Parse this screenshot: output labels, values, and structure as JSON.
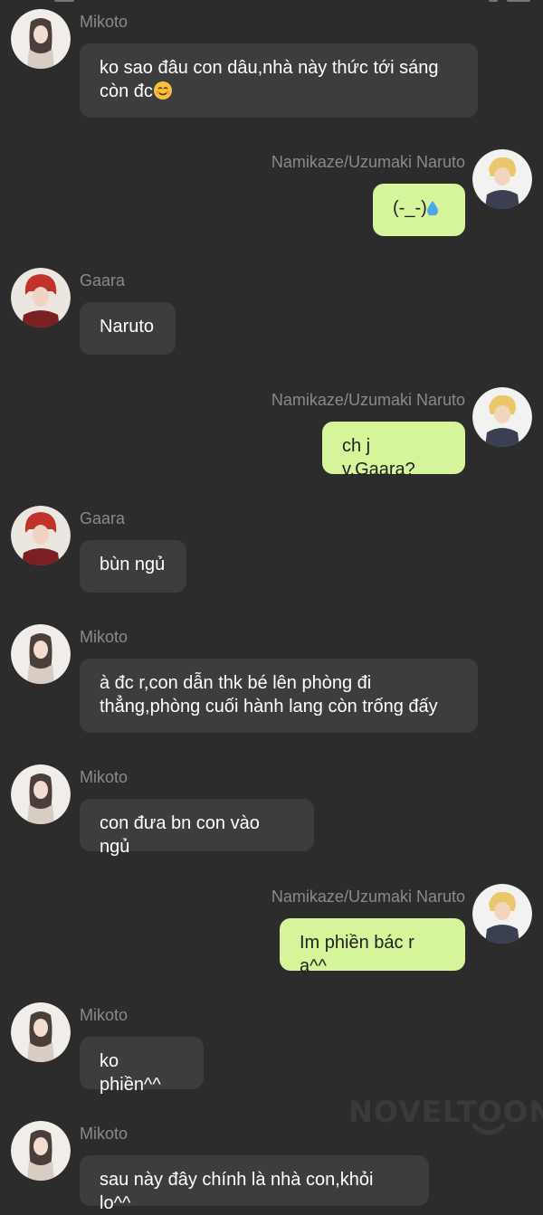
{
  "colors": {
    "background": "#2c2c2c",
    "incoming_bubble": "#3d3d3d",
    "outgoing_bubble": "#d6f59b",
    "name_text": "#8a8a8a"
  },
  "watermark": "NOVELTOON",
  "messages": [
    {
      "sender": "Mikoto",
      "side": "left",
      "avatar": "mikoto-avatar",
      "lines": [
        "ko sao đâu con dâu,nhà này thức tới sáng",
        "còn đc"
      ],
      "emoji": "smiling-face-icon"
    },
    {
      "sender": "Namikaze/Uzumaki Naruto",
      "side": "right",
      "avatar": "naruto-avatar",
      "lines": [
        "(-_-)"
      ],
      "emoji": "water-drop-icon"
    },
    {
      "sender": "Gaara",
      "side": "left",
      "avatar": "gaara-avatar",
      "lines": [
        "Naruto"
      ]
    },
    {
      "sender": "Namikaze/Uzumaki Naruto",
      "side": "right",
      "avatar": "naruto-avatar",
      "lines": [
        "ch j v,Gaara?"
      ]
    },
    {
      "sender": "Gaara",
      "side": "left",
      "avatar": "gaara-avatar",
      "lines": [
        "bùn ngủ"
      ]
    },
    {
      "sender": "Mikoto",
      "side": "left",
      "avatar": "mikoto-avatar",
      "lines": [
        "à đc r,con dẫn thk bé lên phòng đi",
        "thẳng,phòng cuối hành lang còn trống đấy"
      ]
    },
    {
      "sender": "Mikoto",
      "side": "left",
      "avatar": "mikoto-avatar",
      "lines": [
        "con đưa bn con vào ngủ"
      ]
    },
    {
      "sender": "Namikaze/Uzumaki Naruto",
      "side": "right",
      "avatar": "naruto-avatar",
      "lines": [
        "Im phiền bác r ạ^^"
      ]
    },
    {
      "sender": "Mikoto",
      "side": "left",
      "avatar": "mikoto-avatar",
      "lines": [
        "ko phiền^^"
      ]
    },
    {
      "sender": "Mikoto",
      "side": "left",
      "avatar": "mikoto-avatar",
      "lines": [
        "sau này đây chính là nhà con,khỏi lo^^"
      ]
    }
  ]
}
